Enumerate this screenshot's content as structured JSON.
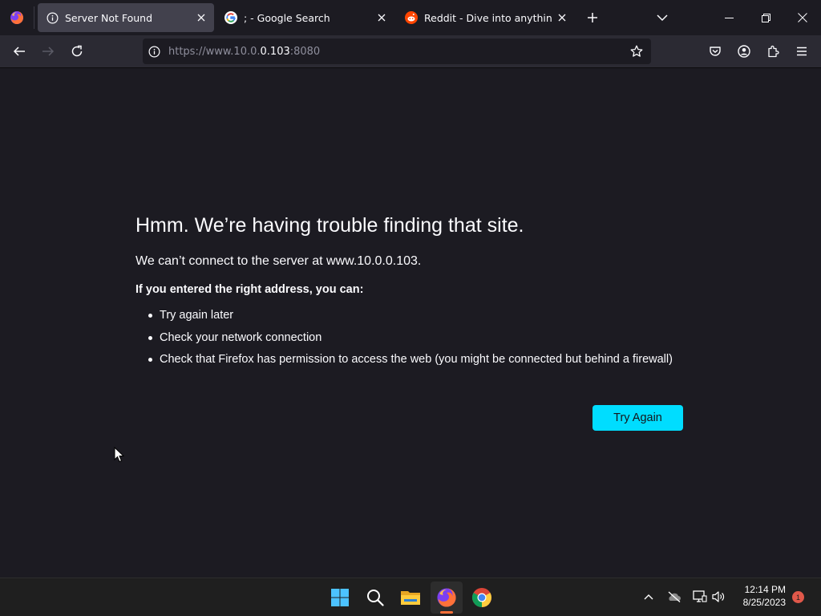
{
  "browser": {
    "tabs": [
      {
        "title": "Server Not Found",
        "active": true,
        "favicon": "info-icon"
      },
      {
        "title": "; - Google Search",
        "active": false,
        "favicon": "google-icon"
      },
      {
        "title": "Reddit - Dive into anything",
        "active": false,
        "favicon": "reddit-icon"
      }
    ],
    "url_prefix": "https://www.10.0.",
    "url_host": "0.103",
    "url_suffix": ":8080"
  },
  "error_page": {
    "title": "Hmm. We’re having trouble finding that site.",
    "subtitle": "We can’t connect to the server at www.10.0.0.103.",
    "lead": "If you entered the right address, you can:",
    "suggestions": [
      "Try again later",
      "Check your network connection",
      "Check that Firefox has permission to access the web (you might be connected but behind a firewall)"
    ],
    "try_again_label": "Try Again"
  },
  "taskbar": {
    "apps": [
      "start-icon",
      "search-icon",
      "file-explorer-icon",
      "firefox-icon",
      "chrome-icon"
    ],
    "time": "12:14 PM",
    "date": "8/25/2023",
    "notification_count": "1"
  },
  "colors": {
    "accent": "#00ddff",
    "background": "#1c1b22",
    "toolbar": "#2b2a33",
    "active_tab": "#42414d"
  }
}
